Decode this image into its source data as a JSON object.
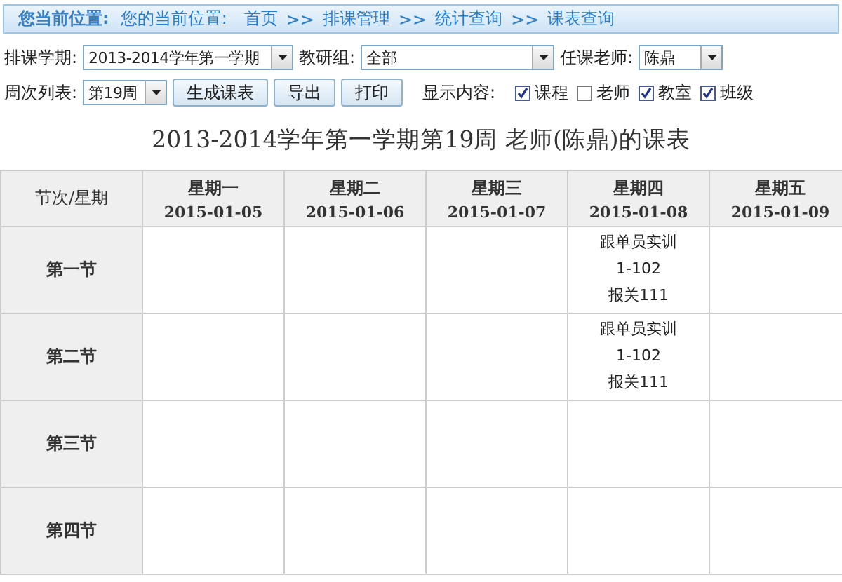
{
  "breadcrumb": {
    "heading": "您当前位置:",
    "label": "您的当前位置:",
    "items": [
      "首页",
      "排课管理",
      "统计查询",
      "课表查询"
    ],
    "separator": ">>"
  },
  "filters": {
    "term": {
      "label": "排课学期:",
      "value": "2013-2014学年第一学期"
    },
    "group": {
      "label": "教研组:",
      "value": "全部"
    },
    "teacher": {
      "label": "任课老师:",
      "value": "陈鼎"
    },
    "week": {
      "label": "周次列表:",
      "value": "第19周"
    }
  },
  "buttons": [
    "生成课表",
    "导出",
    "打印"
  ],
  "display": {
    "label": "显示内容:",
    "options": [
      {
        "label": "课程",
        "checked": true
      },
      {
        "label": "老师",
        "checked": false
      },
      {
        "label": "教室",
        "checked": true
      },
      {
        "label": "班级",
        "checked": true
      }
    ]
  },
  "title": "2013-2014学年第一学期第19周 老师(陈鼎)的课表",
  "table": {
    "corner": "节次/星期",
    "columns": [
      {
        "day": "星期一",
        "date": "2015-01-05"
      },
      {
        "day": "星期二",
        "date": "2015-01-06"
      },
      {
        "day": "星期三",
        "date": "2015-01-07"
      },
      {
        "day": "星期四",
        "date": "2015-01-08"
      },
      {
        "day": "星期五",
        "date": "2015-01-09"
      }
    ],
    "rows": [
      {
        "period": "第一节",
        "cells": [
          {},
          {},
          {},
          {
            "course": "跟单员实训",
            "room": "1-102",
            "class": "报关111"
          },
          {}
        ]
      },
      {
        "period": "第二节",
        "cells": [
          {},
          {},
          {},
          {
            "course": "跟单员实训",
            "room": "1-102",
            "class": "报关111"
          },
          {}
        ]
      },
      {
        "period": "第三节",
        "cells": [
          {},
          {},
          {},
          {},
          {}
        ]
      },
      {
        "period": "第四节",
        "cells": [
          {},
          {},
          {},
          {},
          {}
        ]
      }
    ]
  }
}
